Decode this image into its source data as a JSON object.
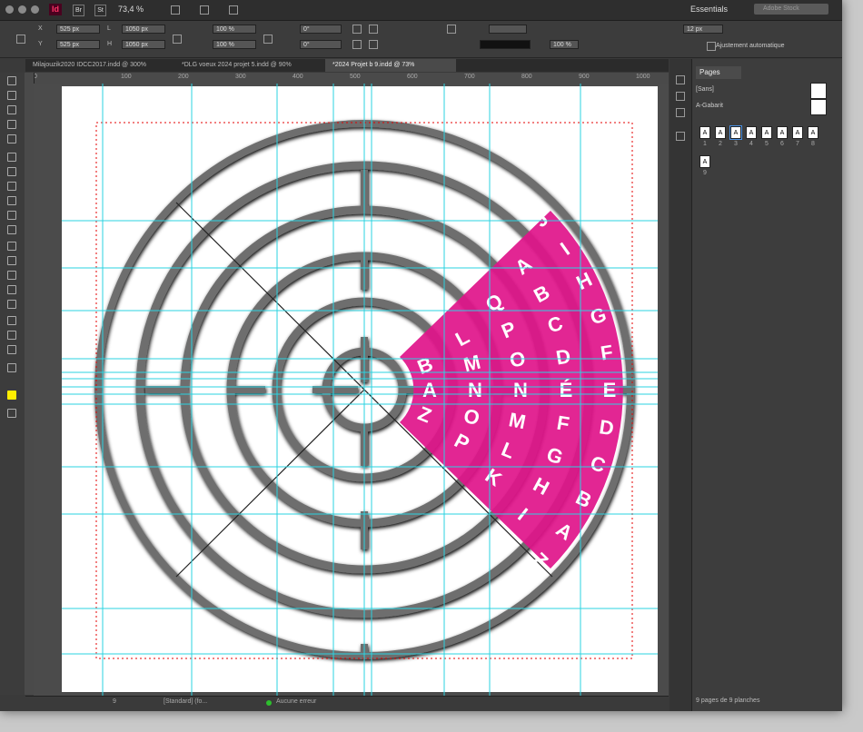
{
  "window": {
    "app_logo": "Id",
    "zoom_display": "73,4 %",
    "workspace": "Essentials",
    "stock_search_placeholder": "Adobe Stock",
    "view_buttons": [
      "Br",
      "St"
    ]
  },
  "control_panel": {
    "x_label": "X",
    "x_value": "525 px",
    "y_label": "Y",
    "y_value": "525 px",
    "w_label": "L",
    "w_value": "1050 px",
    "h_label": "H",
    "h_value": "1050 px",
    "scale_x": "100 %",
    "scale_y": "100 %",
    "angle": "0°",
    "shear": "0°",
    "stroke_weight": "12 px",
    "opacity": "100 %",
    "auto_fit_label": "Ajustement automatique"
  },
  "tabs": [
    {
      "label": "Milajouzik2020 IDCC2017.indd @ 300%",
      "active": false
    },
    {
      "label": "*DLG voeux 2024 projet 5.indd @ 90%",
      "active": false
    },
    {
      "label": "*2024 Projet b 9.indd @ 73%",
      "active": true
    }
  ],
  "ruler": {
    "h_labels": [
      "0",
      "100",
      "200",
      "300",
      "400",
      "500",
      "600",
      "700",
      "800",
      "900",
      "1000"
    ],
    "v_labels": [
      "100",
      "200",
      "300",
      "400",
      "500",
      "600",
      "700",
      "800",
      "900",
      "1000"
    ]
  },
  "artwork": {
    "accent": "#e0138a",
    "outer_ring": [
      "J",
      "I",
      "H",
      "G",
      "F",
      "E",
      "D",
      "C",
      "B",
      "A",
      "Z"
    ],
    "ring2": [
      "A",
      "B",
      "C",
      "D",
      "É",
      "F",
      "G",
      "H",
      "I"
    ],
    "ring3": [
      "Q",
      "P",
      "O",
      "N",
      "M",
      "L",
      "K"
    ],
    "ring4": [
      "L",
      "M",
      "N",
      "O",
      "P"
    ],
    "inner_ring": [
      "B",
      "A",
      "Z"
    ]
  },
  "status_bar": {
    "page": "9",
    "preflight_profile": "[Standard] (fo...",
    "errors": "Aucune erreur"
  },
  "pages_panel": {
    "title": "Pages",
    "masters": [
      "[Sans]",
      "A-Gabarit"
    ],
    "page_labels": [
      "1",
      "2",
      "3",
      "4",
      "5",
      "6",
      "7",
      "8",
      "9"
    ],
    "selected_index": 2,
    "page_letter": "A",
    "footer": "9 pages de 9 planches"
  }
}
